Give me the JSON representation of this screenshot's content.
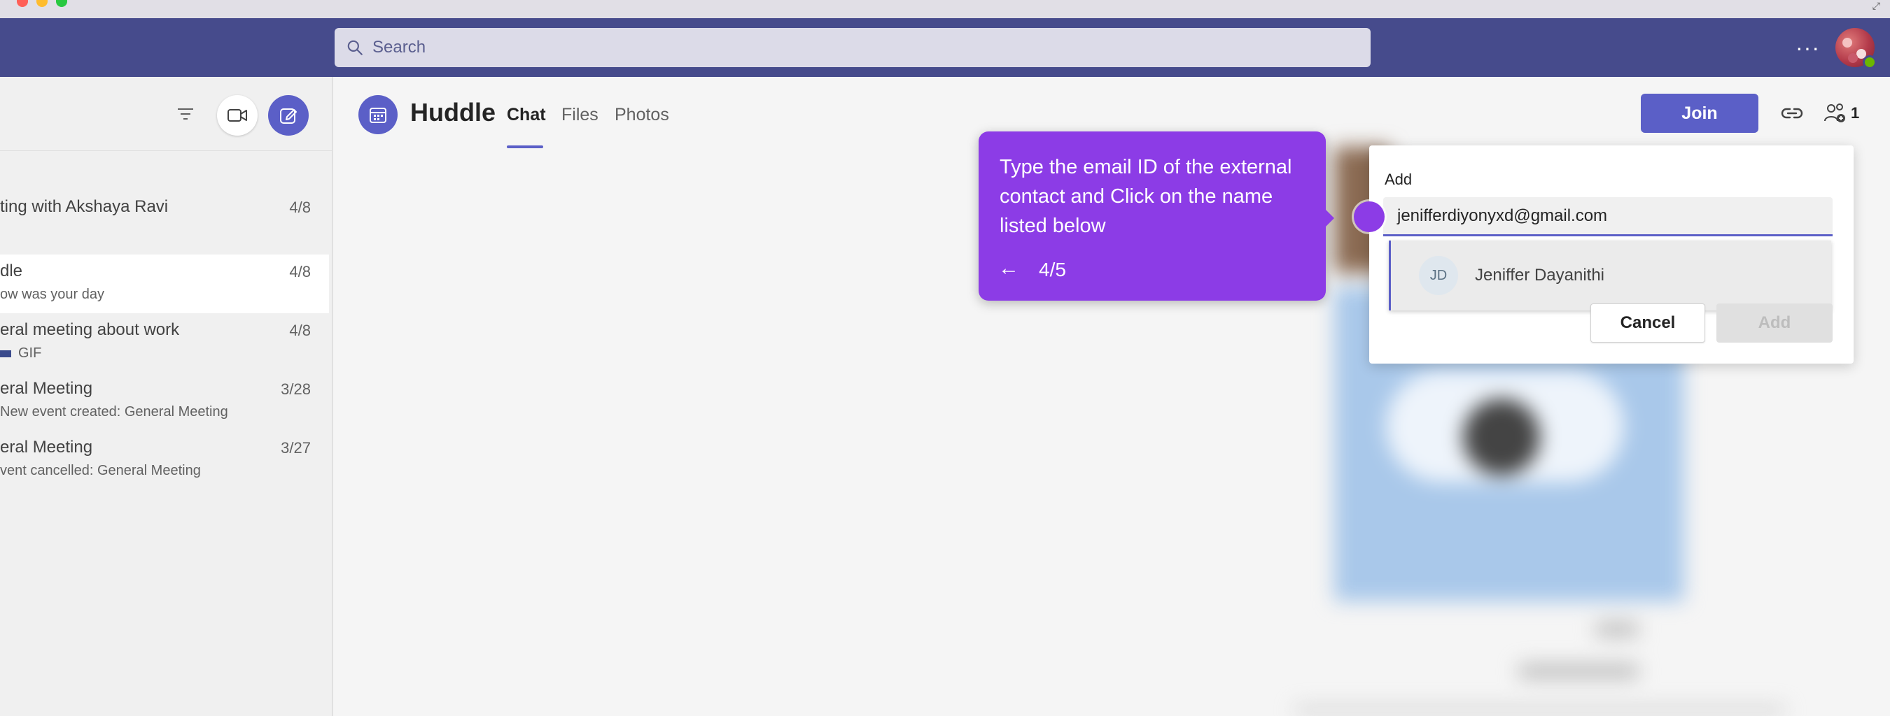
{
  "search": {
    "placeholder": "Search"
  },
  "header": {
    "more_label": "···"
  },
  "chats": [
    {
      "title": "ting with Akshaya Ravi",
      "subtitle": "",
      "date": "4/8"
    },
    {
      "title": "dle",
      "subtitle": "ow was your day",
      "date": "4/8"
    },
    {
      "title": "eral meeting about work",
      "subtitle": "GIF",
      "date": "4/8"
    },
    {
      "title": "eral Meeting",
      "subtitle": "New event created: General Meeting",
      "date": "3/28"
    },
    {
      "title": "eral Meeting",
      "subtitle": "vent cancelled: General Meeting",
      "date": "3/27"
    }
  ],
  "channel": {
    "title": "Huddle",
    "tabs": [
      {
        "label": "Chat",
        "active": true
      },
      {
        "label": "Files",
        "active": false
      },
      {
        "label": "Photos",
        "active": false
      }
    ],
    "join_label": "Join",
    "participant_count": "1"
  },
  "add_dialog": {
    "label": "Add",
    "input_value": "jeniffer​diyonyxd@gmail.com",
    "suggestion": {
      "initials": "JD",
      "name": "Jeniffer Dayanithi"
    },
    "cancel_label": "Cancel",
    "add_label": "Add"
  },
  "guide": {
    "text": "Type the email ID of the external contact and Click on the name listed below",
    "back_icon": "←",
    "step": "4/5"
  },
  "colors": {
    "header": "#464b8c",
    "accent": "#5b5fc7",
    "guide": "#8c3ce6"
  }
}
